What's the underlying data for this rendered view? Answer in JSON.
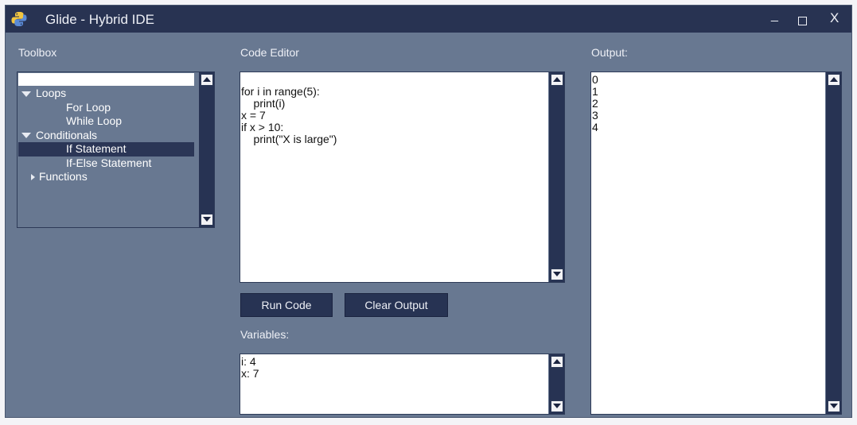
{
  "window": {
    "title": "Glide - Hybrid IDE",
    "controls": {
      "minimize": "_",
      "maximize": "",
      "close": "X"
    },
    "icon": "python-logo-icon"
  },
  "toolbox": {
    "label": "Toolbox",
    "tree": [
      {
        "label": "Loops",
        "level": 1,
        "expanded": true
      },
      {
        "label": "For Loop",
        "level": 2
      },
      {
        "label": "While Loop",
        "level": 2
      },
      {
        "label": "Conditionals",
        "level": 1,
        "expanded": true
      },
      {
        "label": "If Statement",
        "level": 2,
        "selected": true
      },
      {
        "label": "If-Else Statement",
        "level": 2
      },
      {
        "label": "Functions",
        "level": 1,
        "expanded": false
      }
    ]
  },
  "editor": {
    "label": "Code Editor",
    "code": "\nfor i in range(5):\n    print(i)\nx = 7\nif x > 10:\n    print(\"X is large\")"
  },
  "buttons": {
    "run": "Run Code",
    "clear": "Clear Output"
  },
  "variables": {
    "label": "Variables:",
    "text": "i: 4\nx: 7"
  },
  "output": {
    "label": "Output:",
    "text": "0\n1\n2\n3\n4"
  },
  "colors": {
    "window_bg": "#687891",
    "titlebar_bg": "#283352",
    "button_bg": "#273353",
    "scrollbar_bg": "#273353",
    "selected_row": "#2b3656"
  }
}
